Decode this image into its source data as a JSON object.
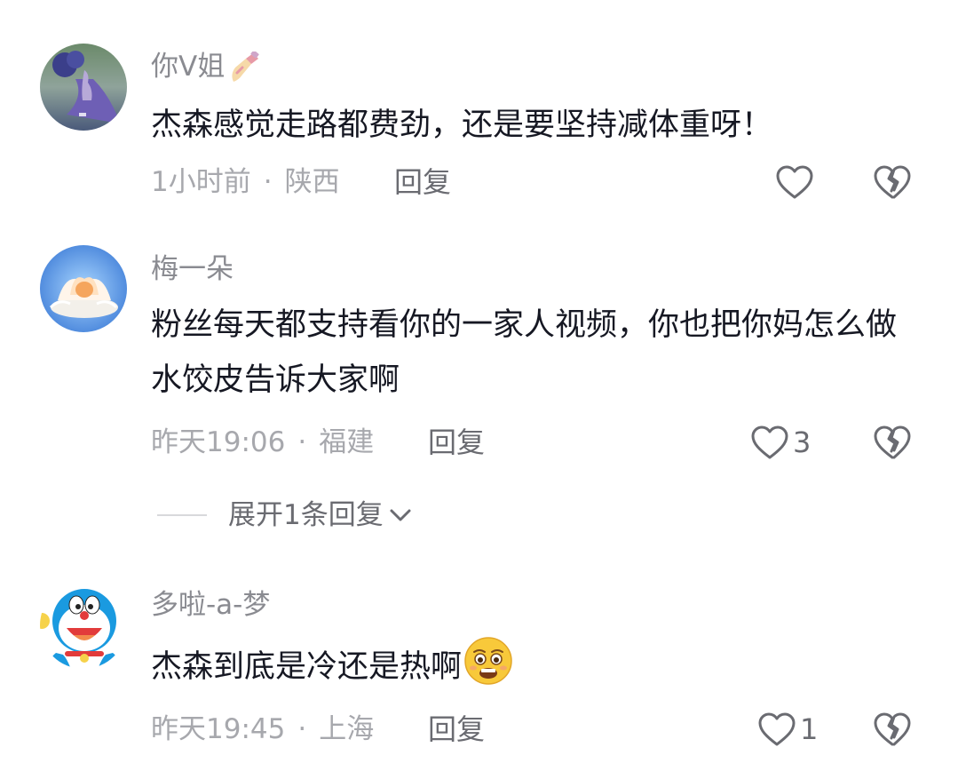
{
  "comments": [
    {
      "username": "你V姐",
      "username_icon": "nail-polish-emoji-icon",
      "content": "杰森感觉走路都费劲，还是要坚持减体重呀！",
      "time": "1小时前",
      "location": "陕西",
      "reply_label": "回复",
      "like_count": ""
    },
    {
      "username": "梅一朵",
      "content": "粉丝每天都支持看你的一家人视频，你也把你妈怎么做水饺皮告诉大家啊",
      "time": "昨天19:06",
      "location": "福建",
      "reply_label": "回复",
      "like_count": "3",
      "expand_label": "展开1条回复"
    },
    {
      "username": "多啦-a-梦",
      "content": "杰森到底是冷还是热啊",
      "content_emoji": "pleading-face-emoji-icon",
      "time": "昨天19:45",
      "location": "上海",
      "reply_label": "回复",
      "like_count": "1"
    }
  ],
  "separator": "·",
  "colors": {
    "username": "#8a8b91",
    "content": "#161823",
    "meta": "#a7a8ad",
    "icon": "#6a6b71"
  }
}
